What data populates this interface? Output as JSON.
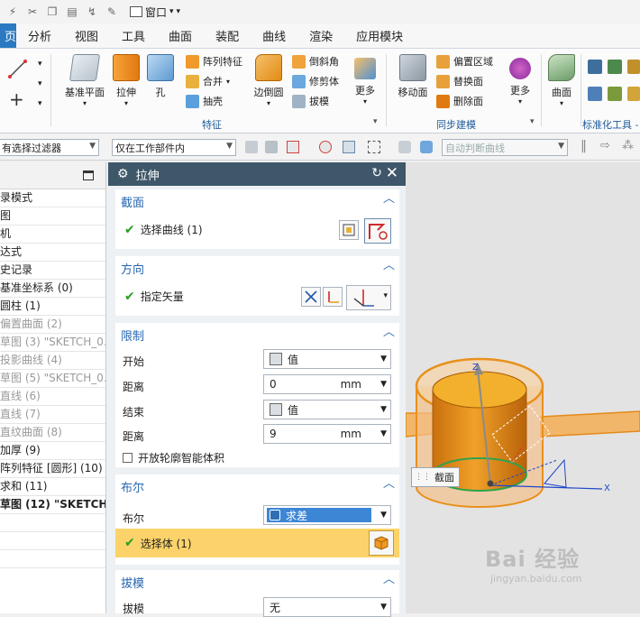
{
  "quick_access": {
    "window_label": "窗口"
  },
  "menu": {
    "tabs": [
      "页",
      "分析",
      "视图",
      "工具",
      "曲面",
      "装配",
      "曲线",
      "渲染",
      "应用模块"
    ]
  },
  "ribbon": {
    "datum_plane": "基准平面",
    "extrude": "拉伸",
    "hole": "孔",
    "pattern_feature": "阵列特征",
    "unite": "合并",
    "shell": "抽壳",
    "edge_blend": "边倒圆",
    "chamfer": "倒斜角",
    "trim_body": "修剪体",
    "draft": "拔模",
    "more1": "更多",
    "move_face": "移动面",
    "offset_region": "偏置区域",
    "replace_face": "替换面",
    "delete_face": "删除面",
    "more2": "更多",
    "surface": "曲面",
    "group_feature": "特征",
    "group_sync": "同步建模",
    "group_std": "标准化工具 -"
  },
  "filterbar": {
    "filter": "有选择过滤器",
    "scope": "仅在工作部件内",
    "curve_rule": "自动判断曲线"
  },
  "navigator": {
    "rows": [
      {
        "text": "录模式",
        "style": "normal"
      },
      {
        "text": "图",
        "style": "normal"
      },
      {
        "text": "机",
        "style": "normal"
      },
      {
        "text": "达式",
        "style": "normal"
      },
      {
        "text": "史记录",
        "style": "normal"
      },
      {
        "text": "基准坐标系 (0)",
        "style": "normal"
      },
      {
        "text": "圆柱 (1)",
        "style": "normal"
      },
      {
        "text": "偏置曲面 (2)",
        "style": "gray"
      },
      {
        "text": "草图 (3) \"SKETCH_0…",
        "style": "gray"
      },
      {
        "text": "投影曲线 (4)",
        "style": "gray"
      },
      {
        "text": "草图 (5) \"SKETCH_0…",
        "style": "gray"
      },
      {
        "text": "直线 (6)",
        "style": "gray"
      },
      {
        "text": "直线 (7)",
        "style": "gray"
      },
      {
        "text": "直纹曲面 (8)",
        "style": "gray"
      },
      {
        "text": "加厚 (9)",
        "style": "normal"
      },
      {
        "text": "阵列特征 [圆形] (10)",
        "style": "normal"
      },
      {
        "text": "求和 (11)",
        "style": "normal"
      },
      {
        "text": "草图 (12) \"SKETCH…",
        "style": "bold"
      }
    ]
  },
  "dialog": {
    "title": "拉伸",
    "section_profile": "截面",
    "select_curve": "选择曲线 (1)",
    "section_direction": "方向",
    "specify_vector": "指定矢量",
    "section_limits": "限制",
    "start_label": "开始",
    "start_value": "值",
    "distance_label": "距离",
    "start_distance": "0",
    "unit": "mm",
    "end_label": "结束",
    "end_value": "值",
    "end_distance": "9",
    "open_profile": "开放轮廓智能体积",
    "section_boolean": "布尔",
    "boolean_label": "布尔",
    "boolean_value": "求差",
    "select_body": "选择体 (1)",
    "section_draft": "拔模",
    "draft_label": "拔模",
    "draft_value": "无"
  },
  "viewport": {
    "tooltip": "截面",
    "axis_z": "Z",
    "axis_x": "X"
  },
  "watermark": {
    "brand": "Bai 经验",
    "url": "jingyan.baidu.com"
  },
  "colors": {
    "accent": "#2b79c2",
    "dialog_header": "#3e5769",
    "check": "#27a020",
    "selection_row": "#fbd36a",
    "body_orange": "#e8901c"
  }
}
